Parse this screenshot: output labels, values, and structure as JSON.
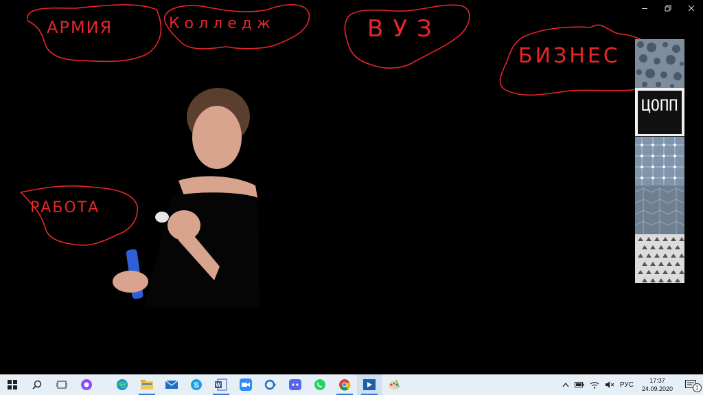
{
  "window": {
    "controls": [
      "minimize",
      "restore",
      "close"
    ]
  },
  "board": {
    "labels": {
      "army": "АРМИЯ",
      "college": "Колледж",
      "university": "ВУЗ",
      "business": "БИЗНЕС",
      "work": "РАБОТА"
    },
    "ink_color": "#e8262a"
  },
  "tiles": {
    "tsopp_logo_text": "ЦОПП"
  },
  "taskbar": {
    "apps": [
      "start-icon",
      "search-icon",
      "task-view-icon",
      "alice-icon",
      "edge-icon",
      "file-explorer-icon",
      "mail-icon",
      "skype-icon",
      "word-icon",
      "zoom-icon",
      "cortana-icon",
      "discord-icon",
      "whatsapp-icon",
      "chrome-icon",
      "media-player-icon",
      "paint-icon"
    ],
    "tray": {
      "language": "РУС",
      "time": "17:37",
      "date": "24.09.2020",
      "notifications": "1"
    }
  }
}
